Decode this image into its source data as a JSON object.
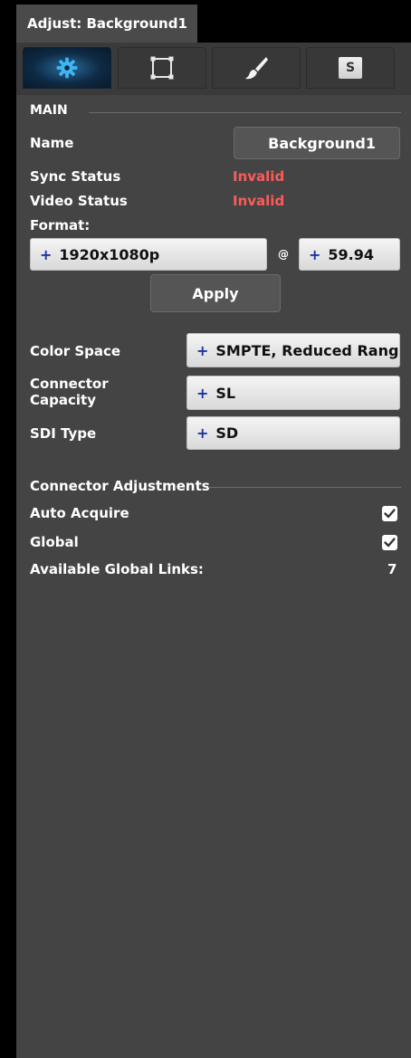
{
  "window": {
    "title": "Adjust: Background1"
  },
  "tabs": [
    {
      "icon": "gear-icon"
    },
    {
      "icon": "crop-frame-icon"
    },
    {
      "icon": "brush-icon"
    },
    {
      "label": "S"
    }
  ],
  "main": {
    "section_label": "MAIN",
    "name_label": "Name",
    "name_value": "Background1",
    "sync_label": "Sync Status",
    "sync_value": "Invalid",
    "video_label": "Video Status",
    "video_value": "Invalid",
    "format_label": "Format:",
    "format_value": "1920x1080p",
    "at_symbol": "@",
    "rate_value": "59.94",
    "apply_label": "Apply",
    "color_space_label": "Color Space",
    "color_space_value": "SMPTE, Reduced Range",
    "capacity_label_1": "Connector",
    "capacity_label_2": "Capacity",
    "capacity_value": "SL",
    "sdi_label": "SDI Type",
    "sdi_value": "SD"
  },
  "connector_adjustments": {
    "section_label": "Connector Adjustments",
    "auto_acquire_label": "Auto Acquire",
    "auto_acquire_checked": true,
    "global_label": "Global",
    "global_checked": true,
    "links_label": "Available Global Links:",
    "links_value": "7"
  },
  "colors": {
    "accent": "#1a32a8",
    "invalid": "#ff5a5a",
    "panel": "#444444"
  }
}
